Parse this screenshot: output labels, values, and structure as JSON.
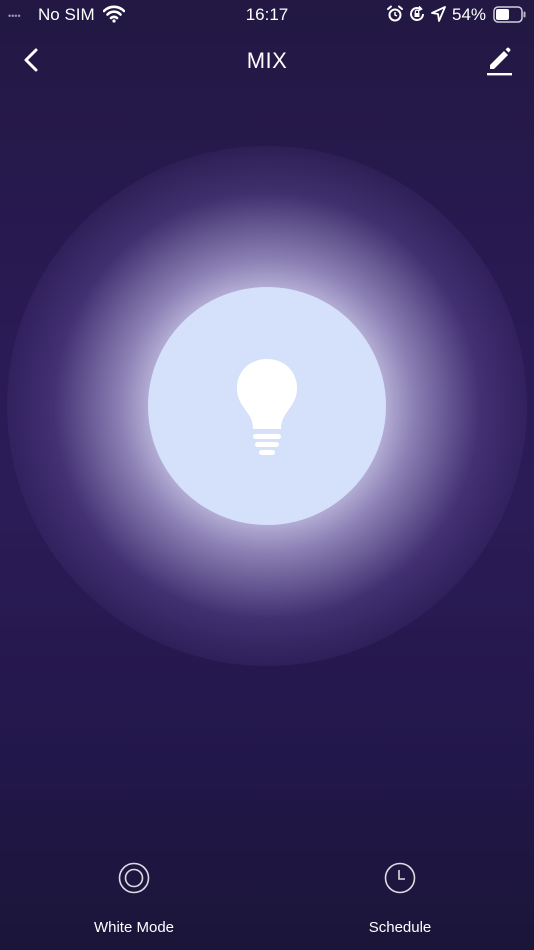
{
  "status_bar": {
    "signal": "••••",
    "carrier": "No SIM",
    "time": "16:17",
    "battery_percent": "54%",
    "battery_level": 0.54,
    "icons": [
      "wifi-icon",
      "alarm-icon",
      "orientation-lock-icon",
      "location-icon",
      "battery-icon"
    ]
  },
  "header": {
    "title": "MIX",
    "back_icon": "chevron-left-icon",
    "edit_icon": "pencil-icon"
  },
  "main": {
    "bulb_icon": "light-bulb-icon",
    "bulb_color": "#d5e0fb",
    "glow_color": "#f0f0ff"
  },
  "bottom_bar": {
    "buttons": [
      {
        "label": "White Mode",
        "icon": "circle-ring-icon"
      },
      {
        "label": "Schedule",
        "icon": "clock-icon"
      }
    ]
  },
  "colors": {
    "background": "#2b1b56",
    "text": "#ffffff"
  }
}
